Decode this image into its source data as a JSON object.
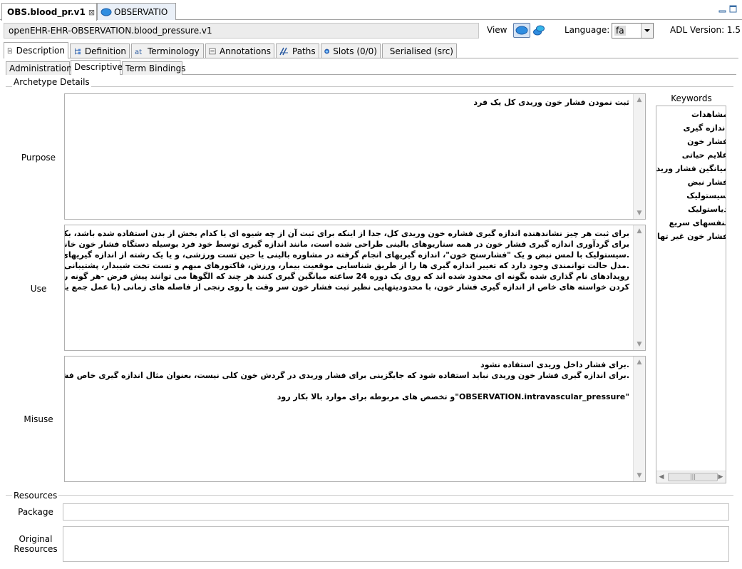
{
  "editor_tabs": [
    {
      "label": "OBS.blood_pr.v1",
      "close": "⊠"
    },
    {
      "label": "OBSERVATIO"
    }
  ],
  "archetype_id": "openEHR-EHR-OBSERVATION.blood_pressure.v1",
  "toolbar": {
    "view_label": "View",
    "language_label": "Language:",
    "language_value": "fa",
    "adl_label": "ADL Version:  1.5"
  },
  "main_tabs": [
    {
      "label": "Description"
    },
    {
      "label": "Definition"
    },
    {
      "label": "Terminology"
    },
    {
      "label": "Annotations"
    },
    {
      "label": "Paths"
    },
    {
      "label": "Slots (0/0)"
    },
    {
      "label": "Serialised (src)"
    }
  ],
  "sub_tabs": [
    {
      "label": "Administration"
    },
    {
      "label": "Descriptive"
    },
    {
      "label": "Term Bindings"
    }
  ],
  "details": {
    "group_title": "Archetype Details",
    "purpose_label": "Purpose",
    "purpose_lines": [
      "ثبت نمودن فشار خون وریدی کل یک فرد"
    ],
    "use_label": "Use",
    "use_lines": [
      "برای ثبت هر چیز نشاندهنده اندازه گیری فشاره خون وریدی کل، جدا از اینکه برای ثبت آن از چه شیوه ای یا کدام بخش از بدن استفاده شده باشد، بکار می رود. این الگوساز",
      "برای گردآوری اندازه گیری فشار خون در همه سناریوهای بالینی طراحی شده است، مانند اندازه گیری توسط خود فرد بوسیله دستگاه فشار خون خانگی، ارزیابی اورژانسی",
      ".سیستولیک با لمس نبض و یک \"فشارسنج خون\"، اندازه گیریهای انجام گرفته در مشاوره بالینی یا حین تست ورزشی، و یا یک رشته از اندازه گیریهای دستگاه مراقبت های ویژه",
      ".مدل حالت توانمندی وجود دارد که تغییر اندازه گیری ها را از طریق شناسایی موقعیت بیمار، ورزش، فاکتورهای مبهم و تست تخت شیبدار، پشتیبانی می کند",
      "رویدادهای نام گذاری شده بگونه ای محدود شده اند که روی یک دوره 24 ساعته میانگین گیری کنند هر چند که الگوها می توانند پیش فرض -هر گونه  رویداد- را برای فراهم",
      "کردن خواسته های خاص از اندازه گیری فشار خون، با محدودیتهایی نظیر ثبت فشار خون سر وقت یا روی رنجی از فاصله های زمانی (با عمل جمع یا منها)، بیشتر محدود کنند"
    ],
    "misuse_label": "Misuse",
    "misuse_lines": [
      ".برای فشار داخل وریدی استفاده نشود",
      ".برای اندازه گیری فشار خون وریدی نباید استفاده شود که جایگزینی برای فشار وریدی در گردش خون کلی نیست، بعنوان مثال اندازه گیری خاص فشار وریدی ریه راست",
      "",
      "\"OBSERVATION.intravascular_pressure\"و تخصص های مربوطه برای موارد بالا بکار رود"
    ]
  },
  "keywords": {
    "title": "Keywords",
    "items": [
      "مشاهدات",
      "اندازه گیری",
      "فشار خون",
      "علایم حیاتی",
      "میانگین فشار وریدی",
      "فشار نبض",
      "سیستولیک",
      "دیاستولیک",
      "تنفسهای سریع",
      "فشار خون غیر تهاجمی"
    ]
  },
  "resources": {
    "group_title": "Resources",
    "package_label": "Package",
    "package_value": "",
    "original_label_1": "Original",
    "original_label_2": "Resources",
    "original_value": ""
  }
}
